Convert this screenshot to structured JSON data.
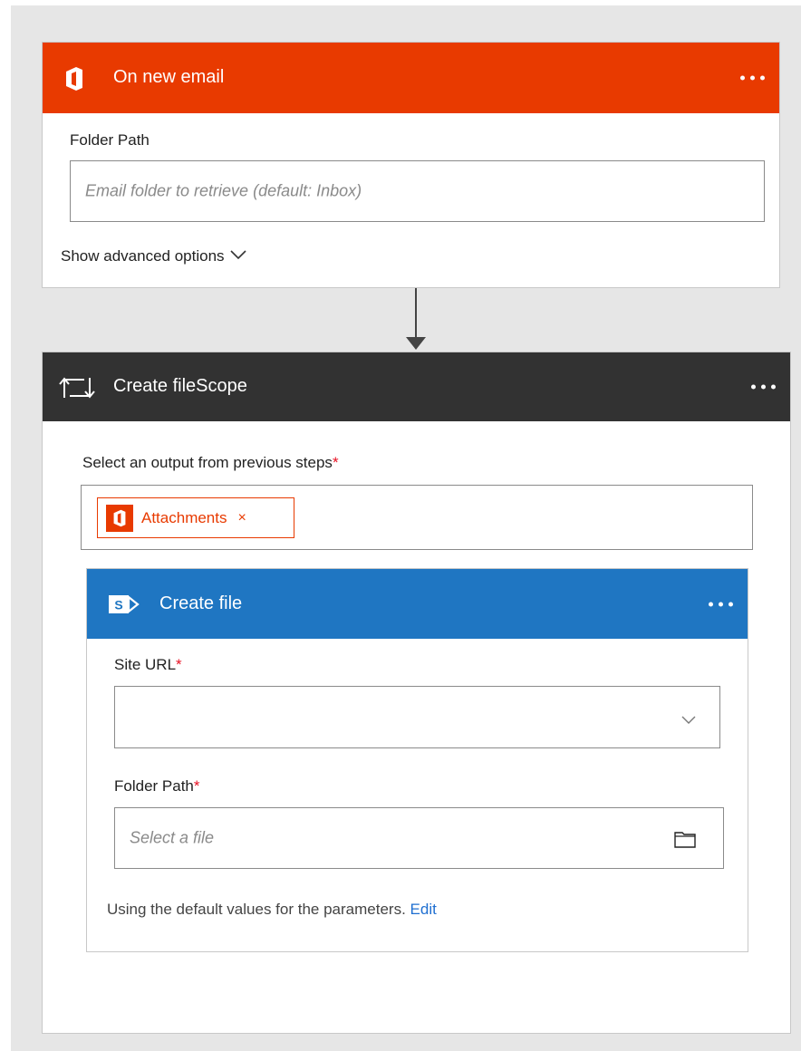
{
  "trigger": {
    "title": "On new email",
    "icon": "office-icon",
    "color": "#e83a00",
    "folder_label": "Folder Path",
    "folder_placeholder": "Email folder to retrieve (default: Inbox)",
    "advanced_link": "Show advanced options"
  },
  "scope": {
    "title": "Create fileScope",
    "icon": "loop-icon",
    "color": "#323232",
    "select_label": "Select an output from previous steps",
    "required_mark": "*",
    "token": {
      "label": "Attachments",
      "remove_glyph": "×",
      "icon": "office-icon"
    }
  },
  "create_file": {
    "title": "Create file",
    "icon": "sharepoint-icon",
    "color": "#1f76c2",
    "site_url_label": "Site URL",
    "folder_path_label": "Folder Path",
    "required_mark": "*",
    "folder_path_placeholder": "Select a file",
    "default_note": "Using the default values for the parameters.",
    "edit_link": "Edit"
  }
}
